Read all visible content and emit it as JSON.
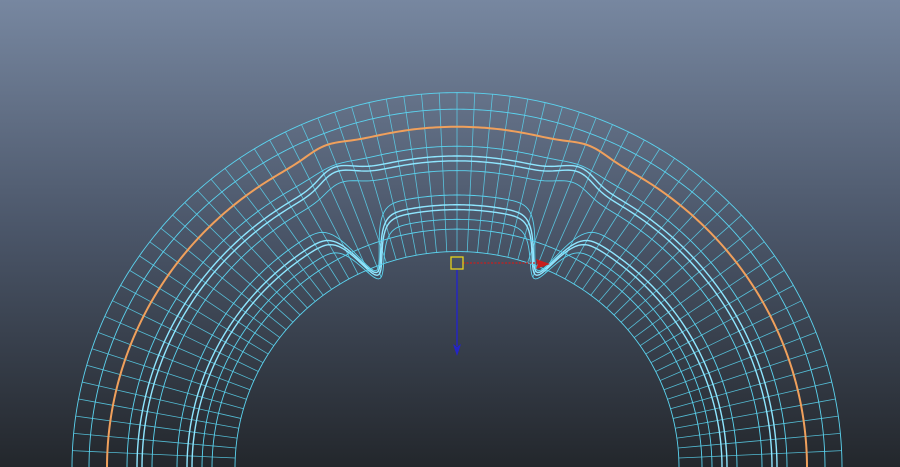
{
  "viewport": {
    "background_top": "#7787a0",
    "background_mid": "#4a5568",
    "background_bottom": "#23272c"
  },
  "mesh": {
    "wire_color": "#5bd3ef",
    "bright_edge_color": "#8fe6ff",
    "selected_edge_color": "#f0a05c",
    "radial_divisions": 68
  },
  "manipulator": {
    "x_axis_color": "#c81e1e",
    "y_axis_color": "#2424c8",
    "pivot_color": "#e8d21a"
  }
}
